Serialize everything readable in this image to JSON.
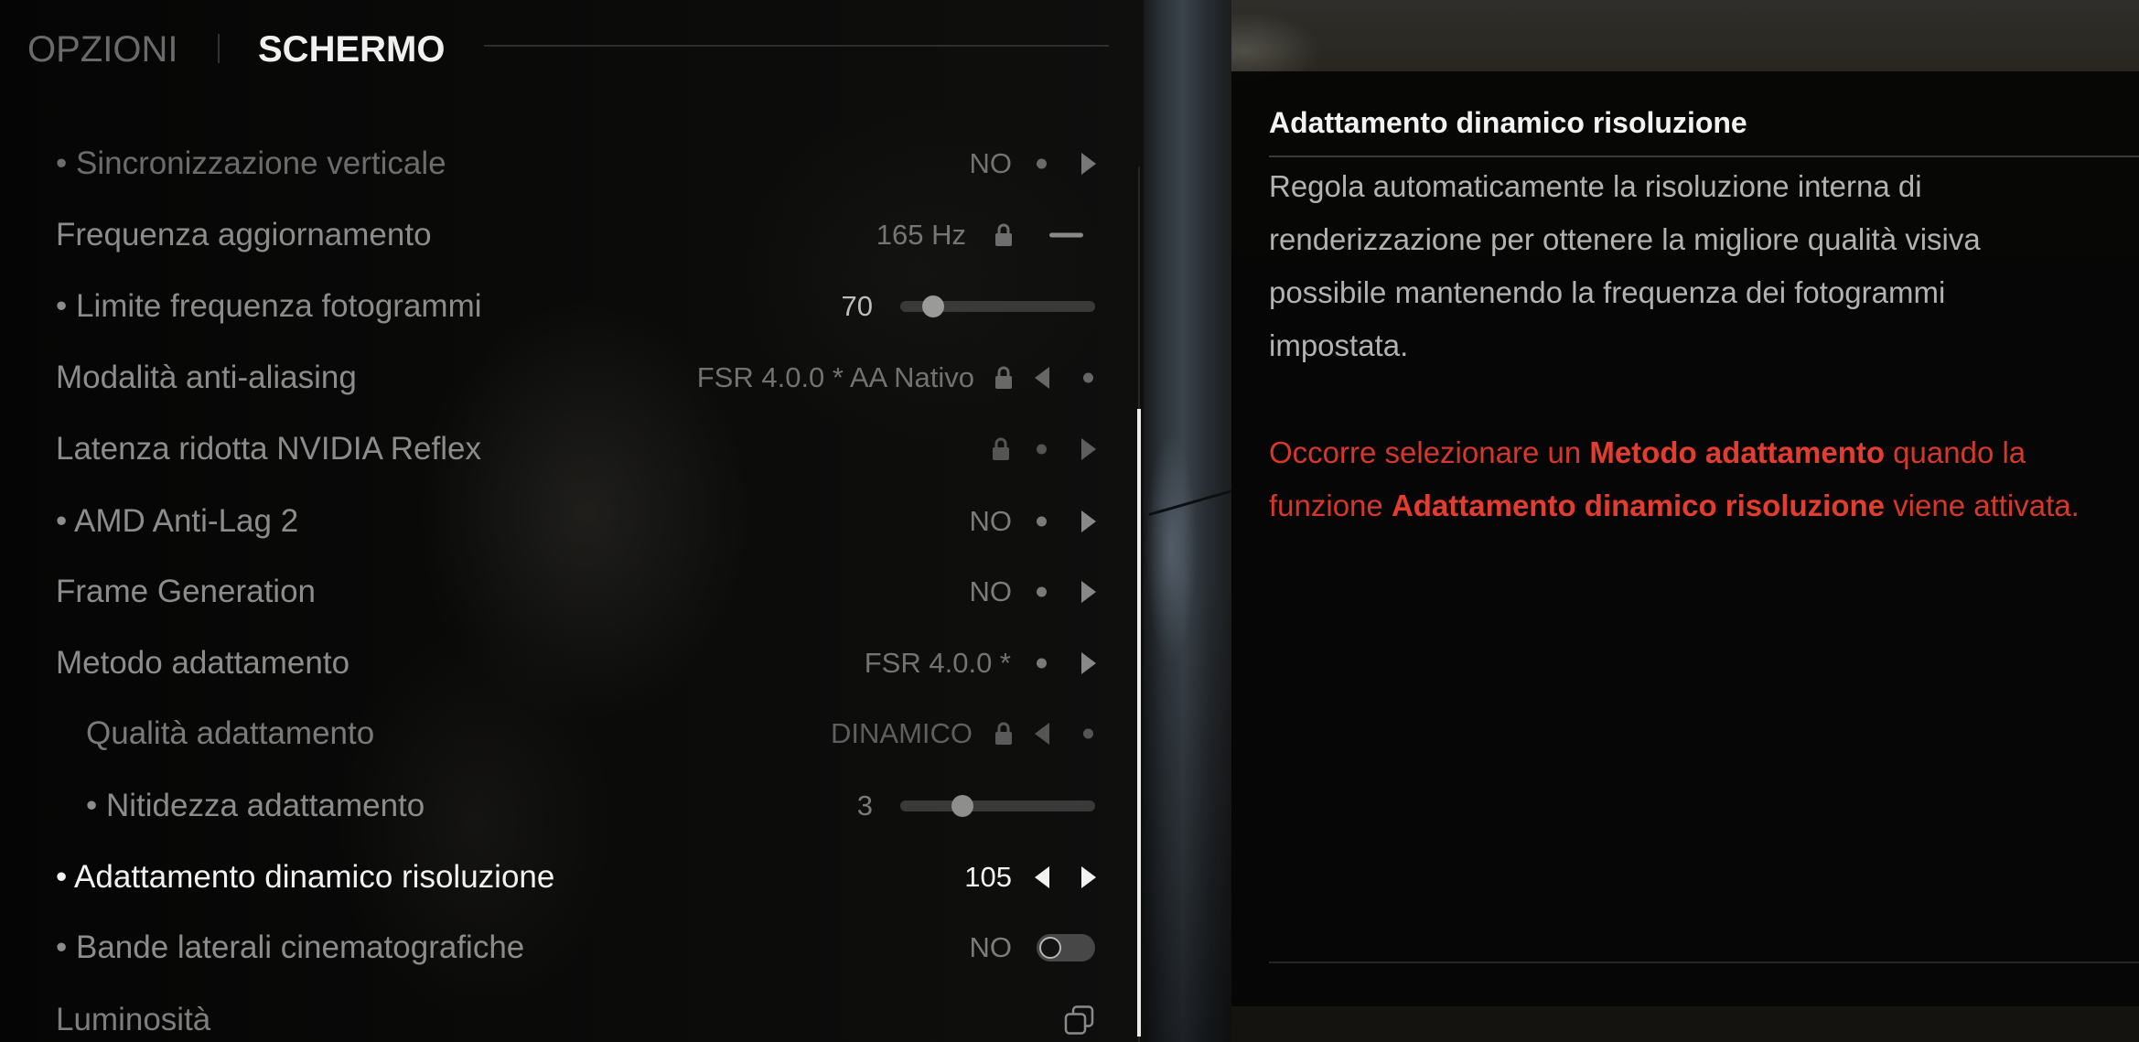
{
  "header": {
    "tab_options": "OPZIONI",
    "section_title": "SCHERMO"
  },
  "settings": [
    {
      "label": "• Sincronizzazione verticale",
      "value": "NO",
      "controls": [
        "dot-icon",
        "arrow-right-icon"
      ]
    },
    {
      "label": "Frequenza aggiornamento",
      "value": "165 Hz",
      "locked": true,
      "controls": [
        "lock-icon",
        "dash-icon"
      ]
    },
    {
      "label": "• Limite frequenza fotogrammi",
      "value": "70",
      "slider_fraction": 0.17,
      "controls": [
        "slider"
      ]
    },
    {
      "label": "Modalità anti-aliasing",
      "value": "FSR 4.0.0 * AA Nativo",
      "locked": true,
      "controls": [
        "lock-icon",
        "arrow-left-icon",
        "dot-icon"
      ]
    },
    {
      "label": "Latenza ridotta NVIDIA Reflex",
      "locked": true,
      "controls": [
        "lock-icon",
        "dot-icon",
        "arrow-right-icon"
      ]
    },
    {
      "label": "• AMD Anti-Lag 2",
      "value": "NO",
      "controls": [
        "dot-icon",
        "arrow-right-icon"
      ]
    },
    {
      "label": "Frame Generation",
      "value": "NO",
      "controls": [
        "dot-icon",
        "arrow-right-icon"
      ]
    },
    {
      "label": "Metodo adattamento",
      "value": "FSR 4.0.0 *",
      "controls": [
        "dot-icon",
        "arrow-right-icon"
      ]
    },
    {
      "label": "Qualità adattamento",
      "value": "DINAMICO",
      "sub_option": true,
      "locked": true,
      "controls": [
        "lock-icon",
        "arrow-left-icon",
        "dot-icon"
      ]
    },
    {
      "label": "• Nitidezza adattamento",
      "value": "3",
      "sub_option": true,
      "slider_fraction": 0.32,
      "controls": [
        "slider"
      ]
    },
    {
      "label": "• Adattamento dinamico risoluzione",
      "value": "105",
      "selected": true,
      "controls": [
        "arrow-left-icon",
        "arrow-right-icon"
      ]
    },
    {
      "label": "• Bande laterali cinematografiche",
      "value": "NO",
      "toggle_on": false,
      "controls": [
        "toggle"
      ]
    },
    {
      "label": "Luminosità",
      "controls": [
        "copy-icon"
      ]
    }
  ],
  "info_panel": {
    "title": "Adattamento dinamico risoluzione",
    "description_lines": [
      "Regola automaticamente la risoluzione interna di",
      "renderizzazione per ottenere la migliore qualità visiva",
      "possibile mantenendo la frequenza dei fotogrammi",
      "impostata."
    ],
    "warning_lines": [
      {
        "before": "Occorre selezionare un ",
        "bold": "Metodo adattamento",
        "after": " quando la"
      },
      {
        "before": "funzione ",
        "bold": "Adattamento dinamico risoluzione",
        "after": " viene attivata."
      }
    ]
  },
  "colors": {
    "text_selected": "#f2f2f2",
    "text_normal": "#8c8c8c",
    "warning_red": "#d6372b",
    "warning_red_strong": "#e23d2e",
    "scrollbar_thumb": "#ececec"
  }
}
